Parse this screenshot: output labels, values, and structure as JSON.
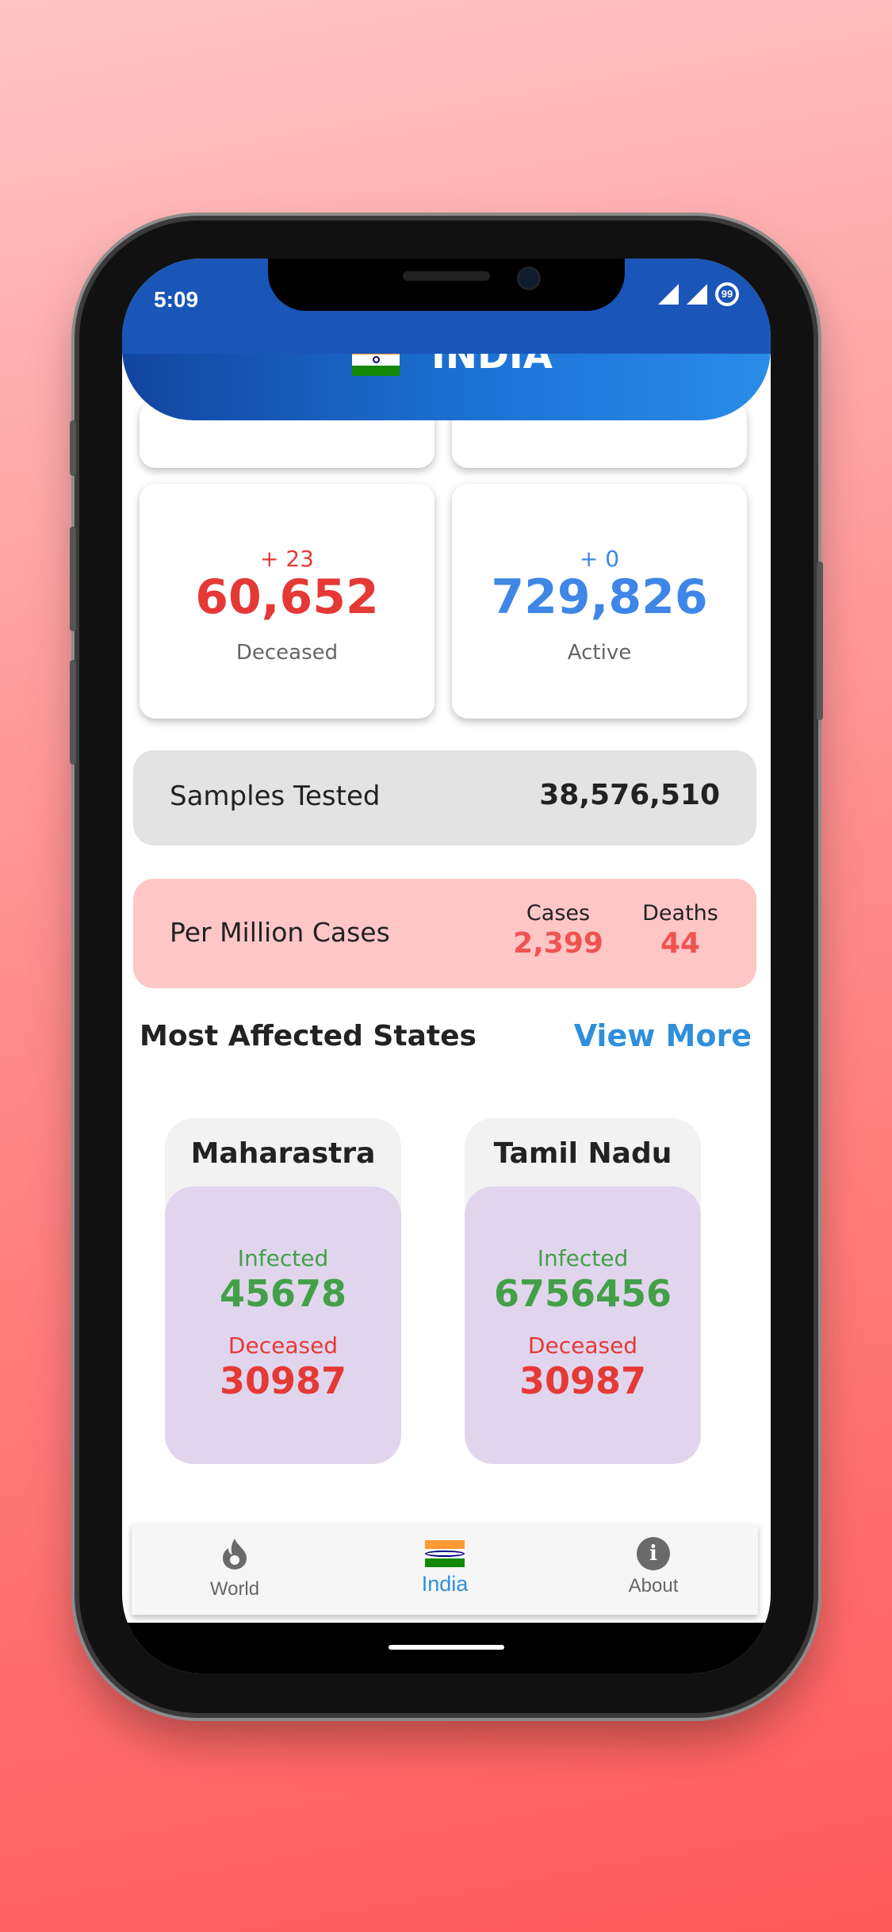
{
  "status": {
    "time": "5:09",
    "battery": "99"
  },
  "header": {
    "title": "INDIA"
  },
  "stats": {
    "deceased": {
      "delta": "+ 23",
      "value": "60,652",
      "label": "Deceased"
    },
    "active": {
      "delta": "+ 0",
      "value": "729,826",
      "label": "Active"
    }
  },
  "samples": {
    "label": "Samples Tested",
    "value": "38,576,510"
  },
  "per_million": {
    "label": "Per Million Cases",
    "cases_label": "Cases",
    "cases_value": "2,399",
    "deaths_label": "Deaths",
    "deaths_value": "44"
  },
  "section": {
    "title": "Most Affected States",
    "view_more": "View More"
  },
  "states": [
    {
      "name": "Maharastra",
      "infected_label": "Infected",
      "infected": "45678",
      "deceased_label": "Deceased",
      "deceased": "30987"
    },
    {
      "name": "Tamil Nadu",
      "infected_label": "Infected",
      "infected": "6756456",
      "deceased_label": "Deceased",
      "deceased": "30987"
    }
  ],
  "nav": {
    "items": [
      {
        "label": "World",
        "icon": "fire-icon"
      },
      {
        "label": "India",
        "icon": "india-flag-icon",
        "active": true
      },
      {
        "label": "About",
        "icon": "info-icon"
      }
    ]
  },
  "colors": {
    "header_start": "#1245a0",
    "header_end": "#2a8ce8",
    "deceased": "#e53935",
    "active": "#3f86e6",
    "infected": "#43a047",
    "link": "#2f8fdc",
    "per_million_bg": "#ffc6c6",
    "state_inner_bg": "#e1d5ee"
  }
}
